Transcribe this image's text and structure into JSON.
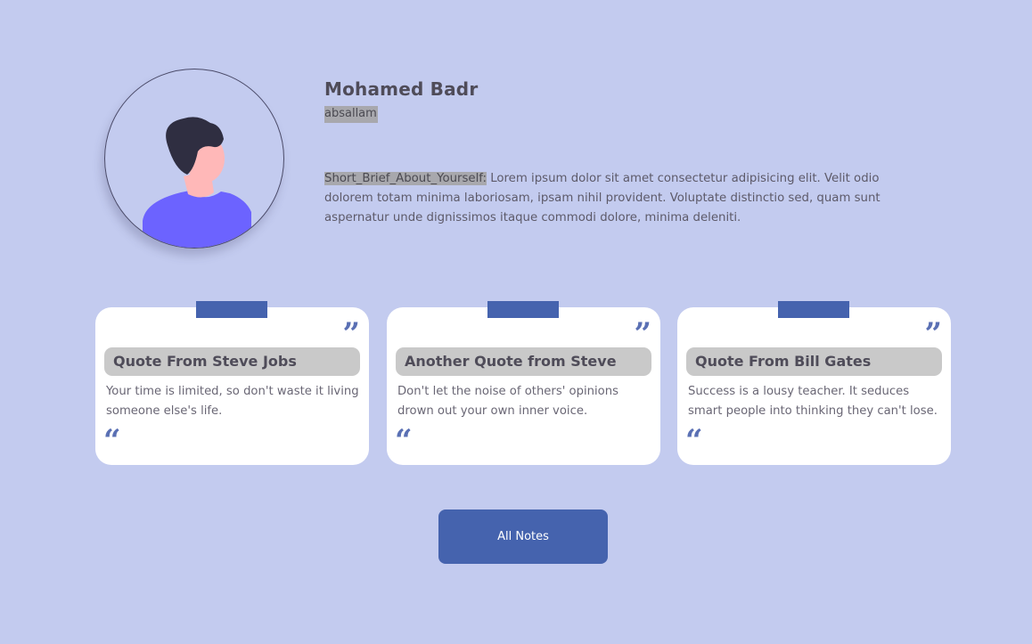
{
  "profile": {
    "name": "Mohamed Badr",
    "username": "absallam",
    "bio_label": "Short_Brief_About_Yourself:",
    "bio_text": " Lorem ipsum dolor sit amet consectetur adipisicing elit. Velit odio dolorem totam minima laboriosam, ipsam nihil provident. Voluptate distinctio sed, quam sunt aspernatur unde dignissimos itaque commodi dolore, minima deleniti.",
    "avatar_icon": "person-avatar-icon"
  },
  "quotes": [
    {
      "title": "Quote From Steve Jobs",
      "text": "Your time is limited, so don't waste it living someone else's life."
    },
    {
      "title": "Another Quote from Steve",
      "text": "Don't let the noise of others' opinions drown out your own inner voice."
    },
    {
      "title": "Quote From Bill Gates",
      "text": "Success is a lousy teacher. It seduces smart people into thinking they can't lose."
    }
  ],
  "quote_marks": {
    "close": "”",
    "open": "“"
  },
  "actions": {
    "all_notes_label": "All Notes"
  },
  "colors": {
    "background": "#c3cbef",
    "accent": "#4563ae",
    "card": "#ffffff",
    "title_bar": "#c9c9c9",
    "avatar_shirt": "#6c63ff",
    "avatar_hair": "#2f2e41",
    "avatar_skin": "#ffb8b8"
  }
}
